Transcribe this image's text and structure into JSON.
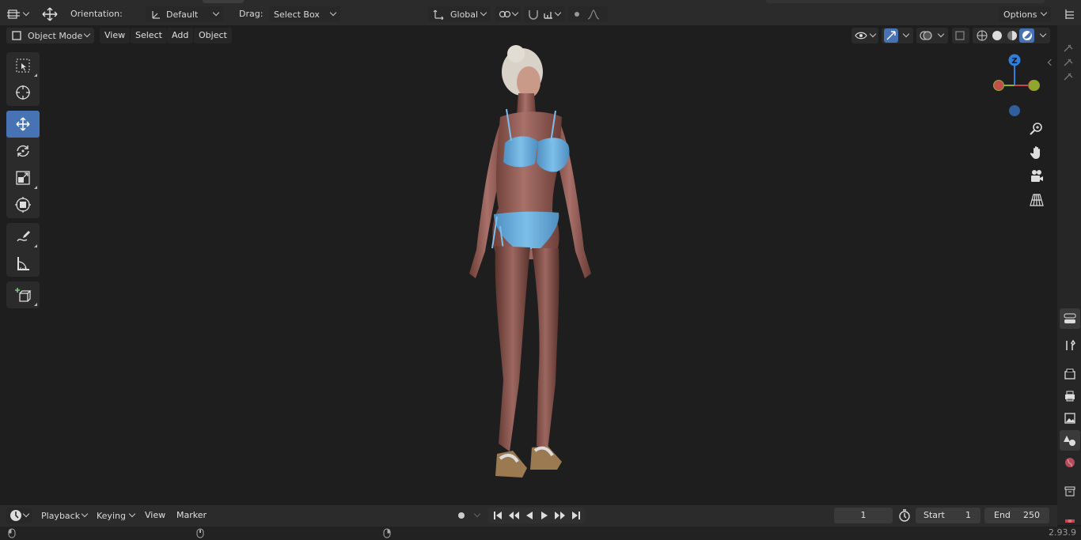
{
  "header": {
    "orientation_label": "Orientation:",
    "orientation_value": "Default",
    "drag_label": "Drag:",
    "drag_value": "Select Box",
    "transform_space": "Global",
    "options_label": "Options"
  },
  "viewport_header": {
    "mode": "Object Mode",
    "menus": [
      "View",
      "Select",
      "Add",
      "Object"
    ]
  },
  "gizmo": {
    "z_label": "Z"
  },
  "timeline": {
    "playback": "Playback",
    "keying": "Keying",
    "view": "View",
    "marker": "Marker",
    "current_frame": "1",
    "start_label": "Start",
    "start_value": "1",
    "end_label": "End",
    "end_value": "250"
  },
  "status": {
    "version": "2.93.9"
  },
  "colors": {
    "accent": "#4772b3",
    "gizmo_x": "#c94452",
    "gizmo_y": "#89b32a",
    "gizmo_z": "#2f7fd8",
    "bikini": "#6fb0e0"
  }
}
